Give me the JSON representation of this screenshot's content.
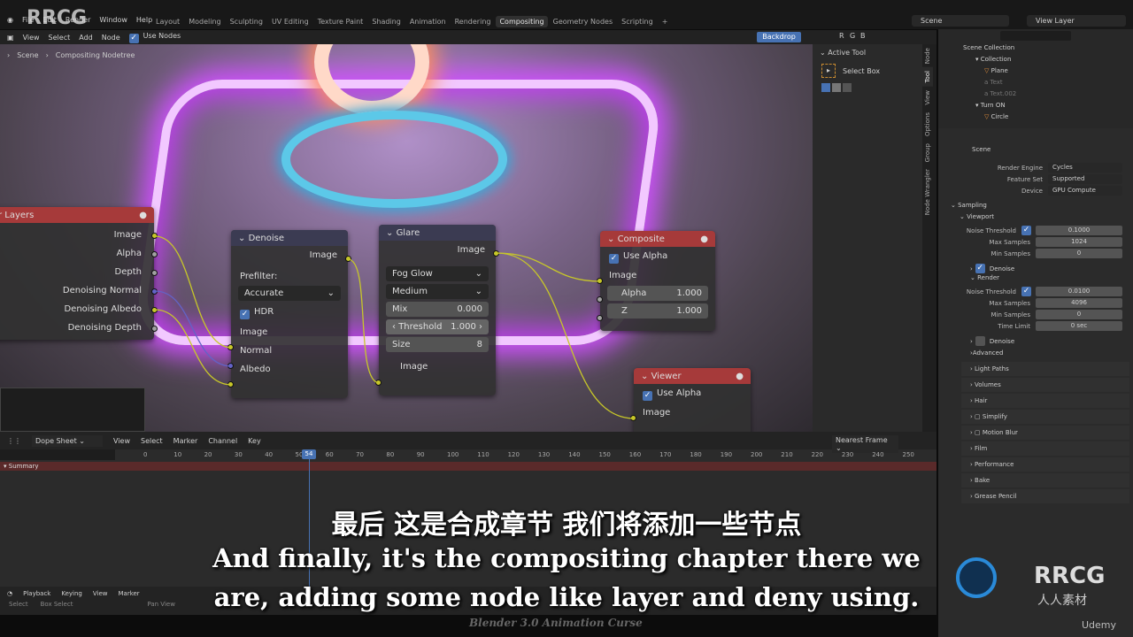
{
  "topbar": {
    "menus": [
      "File",
      "Edit",
      "Render",
      "Window",
      "Help"
    ],
    "workspaces": [
      "Layout",
      "Modeling",
      "Sculpting",
      "UV Editing",
      "Texture Paint",
      "Shading",
      "Animation",
      "Rendering",
      "Compositing",
      "Geometry Nodes",
      "Scripting"
    ],
    "active_workspace": "Compositing",
    "add": "+",
    "scene": "Scene",
    "view_layer": "View Layer"
  },
  "ne_header": {
    "menus": [
      "View",
      "Select",
      "Add",
      "Node"
    ],
    "use_nodes": "Use Nodes",
    "backdrop": "Backdrop",
    "channels": [
      "R",
      "G",
      "B"
    ]
  },
  "breadcrumb": [
    "Scene",
    "Compositing Nodetree"
  ],
  "nodes": {
    "render_layers": {
      "title": "r Layers",
      "outputs": [
        "Image",
        "Alpha",
        "Depth",
        "Denoising Normal",
        "Denoising Albedo",
        "Denoising Depth"
      ]
    },
    "denoise": {
      "title": "Denoise",
      "out": "Image",
      "prefilter_label": "Prefilter:",
      "prefilter": "Accurate",
      "hdr": "HDR",
      "inputs": [
        "Image",
        "Normal",
        "Albedo"
      ]
    },
    "glare": {
      "title": "Glare",
      "out": "Image",
      "type": "Fog Glow",
      "quality": "Medium",
      "mix_label": "Mix",
      "mix": "0.000",
      "threshold_label": "Threshold",
      "threshold": "1.000",
      "size_label": "Size",
      "size": "8",
      "in": "Image"
    },
    "composite": {
      "title": "Composite",
      "use_alpha": "Use Alpha",
      "in": "Image",
      "alpha_label": "Alpha",
      "alpha": "1.000",
      "z_label": "Z",
      "z": "1.000"
    },
    "viewer": {
      "title": "Viewer",
      "use_alpha": "Use Alpha",
      "in": "Image"
    }
  },
  "npanel": {
    "section": "Active Tool",
    "tool": "Select Box",
    "tabs": [
      "Node",
      "Tool",
      "View",
      "Options",
      "Group",
      "Node Wrangler"
    ]
  },
  "outliner": {
    "root": "Scene Collection",
    "items": [
      {
        "name": "Collection",
        "level": 1
      },
      {
        "name": "Plane",
        "level": 2
      },
      {
        "name": "Text",
        "level": 2
      },
      {
        "name": "Text.002",
        "level": 2
      },
      {
        "name": "Turn ON",
        "level": 1
      },
      {
        "name": "Circle",
        "level": 2
      }
    ]
  },
  "properties": {
    "scene": "Scene",
    "render_engine_label": "Render Engine",
    "render_engine": "Cycles",
    "feature_set_label": "Feature Set",
    "feature_set": "Supported",
    "device_label": "Device",
    "device": "GPU Compute",
    "sampling": "Sampling",
    "viewport": "Viewport",
    "vp_noise_label": "Noise Threshold",
    "vp_noise": "0.1000",
    "vp_max_label": "Max Samples",
    "vp_max": "1024",
    "vp_min_label": "Min Samples",
    "vp_min": "0",
    "vp_denoise": "Denoise",
    "render": "Render",
    "r_noise_label": "Noise Threshold",
    "r_noise": "0.0100",
    "r_max_label": "Max Samples",
    "r_max": "4096",
    "r_min_label": "Min Samples",
    "r_min": "0",
    "r_time_label": "Time Limit",
    "r_time": "0 sec",
    "r_denoise": "Denoise",
    "advanced": "Advanced",
    "sections": [
      "Light Paths",
      "Volumes",
      "Hair",
      "Simplify",
      "Motion Blur",
      "Film",
      "Performance",
      "Bake",
      "Grease Pencil"
    ]
  },
  "dope": {
    "mode": "Dope Sheet",
    "menus": [
      "View",
      "Select",
      "Marker",
      "Channel",
      "Key"
    ],
    "snap": "Nearest Frame",
    "summary": "Summary",
    "current_frame": "54",
    "ticks": [
      "0",
      "10",
      "20",
      "30",
      "40",
      "50",
      "60",
      "70",
      "80",
      "90",
      "100",
      "110",
      "120",
      "130",
      "140",
      "150",
      "160",
      "170",
      "180",
      "190",
      "200",
      "210",
      "220",
      "230",
      "240",
      "250"
    ]
  },
  "timeline": {
    "menus": [
      "Playback",
      "Keying",
      "View",
      "Marker"
    ],
    "status": [
      "Select",
      "Box Select",
      "Pan View"
    ]
  },
  "subtitles": {
    "zh": "最后 这是合成章节 我们将添加一些节点",
    "en1": "And finally, it's the compositing chapter there we",
    "en2": "are, adding some node like layer and deny using."
  },
  "watermark": {
    "course": "Blender 3.0 Animation Curse",
    "brand": "RRCG",
    "brand_cn": "人人素材",
    "udemy": "Udemy"
  }
}
